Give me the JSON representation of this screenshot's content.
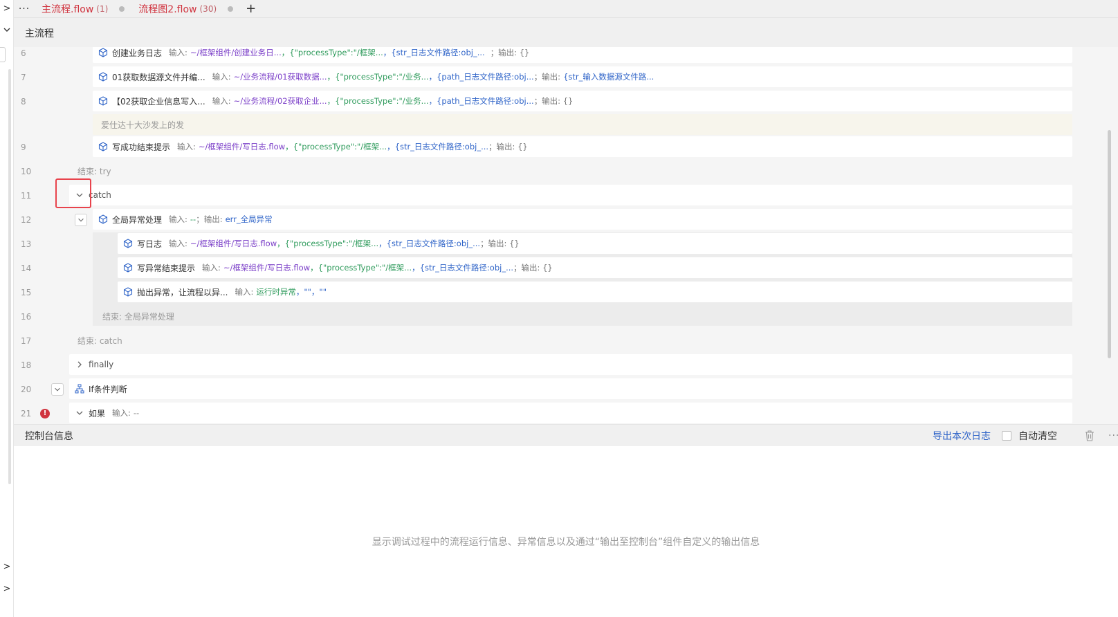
{
  "tabs": [
    {
      "name": "主流程.flow",
      "count": "(1)"
    },
    {
      "name": "流程图2.flow",
      "count": "(30)"
    }
  ],
  "tab_more": "···",
  "tab_add": "+",
  "flow_title": "主流程",
  "rows": {
    "r6": {
      "ln": "6",
      "name": "创建业务日志",
      "in_label": "输入:",
      "a": "~/框架组件/创建业务日...",
      "b": "，{\"processType\":\"/框架...",
      "c": "，{str_日志文件路径:obj_...",
      "out": "；输出: {}"
    },
    "r7": {
      "ln": "7",
      "name": "01获取数据源文件并编...",
      "in_label": "输入:",
      "a": "~/业务流程/01获取数据...",
      "b": "，{\"processType\":\"/业务...",
      "c": "，{path_日志文件路径:obj...",
      "out": "；输出:",
      "d": "{str_输入数据源文件路..."
    },
    "r8": {
      "ln": "8",
      "name": "【02获取企业信息写入...",
      "in_label": "输入:",
      "a": "~/业务流程/02获取企业...",
      "b": "，{\"processType\":\"/业务...",
      "c": "，{path_日志文件路径:obj...",
      "out": "；输出: {}"
    },
    "note": "爱仕达十大沙发上的发",
    "r9": {
      "ln": "9",
      "name": "写成功结束提示",
      "in_label": "输入:",
      "a": "~/框架组件/写日志.flow",
      "b": "，{\"processType\":\"/框架...",
      "c": "，{str_日志文件路径:obj_...",
      "out": "；输出: {}"
    },
    "r10": {
      "ln": "10",
      "text": "结束:  try"
    },
    "r11": {
      "ln": "11",
      "text": "catch"
    },
    "r12": {
      "ln": "12",
      "name": "全局异常处理",
      "in_label": "输入:",
      "a": "--",
      "out": "；输出:",
      "d": "err_全局异常"
    },
    "r13": {
      "ln": "13",
      "name": "写日志",
      "in_label": "输入:",
      "a": "~/框架组件/写日志.flow",
      "b": "，{\"processType\":\"/框架...",
      "c": "，{str_日志文件路径:obj_...",
      "out": "；输出: {}"
    },
    "r14": {
      "ln": "14",
      "name": "写异常结束提示",
      "in_label": "输入:",
      "a": "~/框架组件/写日志.flow",
      "b": "，{\"processType\":\"/框架...",
      "c": "，{str_日志文件路径:obj_...",
      "out": "；输出: {}"
    },
    "r15": {
      "ln": "15",
      "name": "抛出异常，让流程以异...",
      "in_label": "输入:",
      "g": "运行时异常",
      "rest": "，\"\"，\"\""
    },
    "r16": {
      "ln": "16",
      "text": "结束:  全局异常处理"
    },
    "r17": {
      "ln": "17",
      "text": "结束:  catch"
    },
    "r18": {
      "ln": "18",
      "text": "finally"
    },
    "r20": {
      "ln": "20",
      "text": "If条件判断"
    },
    "r21": {
      "ln": "21",
      "text": "如果",
      "in_label": "输入:",
      "a": "--",
      "badge": "!"
    }
  },
  "console": {
    "title": "控制台信息",
    "export": "导出本次日志",
    "auto_clear": "自动清空",
    "more": "···",
    "empty": "显示调试过程中的流程运行信息、异常信息以及通过“输出至控制台”组件自定义的输出信息"
  },
  "colors": {
    "accent_red": "#d0343f",
    "link_blue": "#2f64c8",
    "path_purple": "#7b3fc8",
    "json_green": "#2f9b5c"
  },
  "icons": {
    "node": "cube-icon",
    "branch": "branch-icon",
    "collapse": "chevron-down-icon",
    "expand": "chevron-right-icon",
    "trash": "trash-icon"
  }
}
